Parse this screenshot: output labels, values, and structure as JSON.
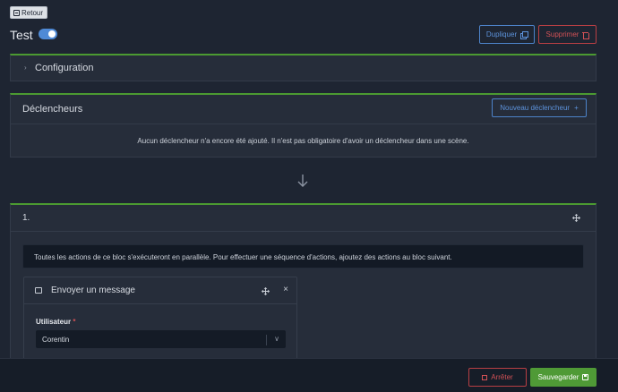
{
  "header": {
    "back_label": "Retour",
    "title": "Test",
    "active_toggle": {
      "on": true
    },
    "duplicate_label": "Dupliquer",
    "delete_label": "Supprimer"
  },
  "configuration": {
    "label": "Configuration"
  },
  "triggers": {
    "label": "Déclencheurs",
    "new_label": "Nouveau déclencheur",
    "new_icon": "+",
    "empty_message": "Aucun déclencheur n'a encore été ajouté. Il n'est pas obligatoire d'avoir un déclencheur dans une scène."
  },
  "block": {
    "number": "1.",
    "info": "Toutes les actions de ce bloc s'exécuteront en parallèle. Pour effectuer une séquence d'actions, ajoutez des actions au bloc suivant.",
    "action": {
      "title": "Envoyer un message",
      "close_glyph": "×",
      "field_label": "Utilisateur",
      "required_mark": "*",
      "field_value": "Corentin"
    }
  },
  "footer": {
    "stop_label": "Arrêter",
    "save_label": "Sauvegarder"
  },
  "colors": {
    "accent_green": "#4f9a36",
    "accent_blue": "#5d93dc",
    "danger_red": "#d25156",
    "background": "#1e2532"
  },
  "icons": [
    "back-icon",
    "copy-icon",
    "trash-icon",
    "chevron-right-icon",
    "plus-icon",
    "arrow-down-icon",
    "move-icon",
    "message-icon",
    "close-icon",
    "chevron-down-icon",
    "stop-icon",
    "save-icon"
  ]
}
